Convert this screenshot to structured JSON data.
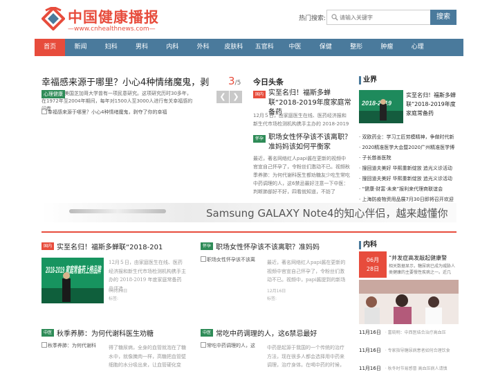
{
  "header": {
    "logo_title": "中国健康播报",
    "logo_url": "—www.cnhealthnews.com—",
    "search_label": "热门搜索:",
    "search_placeholder": "请输入关键字",
    "search_button": "搜索"
  },
  "nav": [
    "首页",
    "新闻",
    "妇科",
    "男科",
    "内科",
    "外科",
    "皮肤科",
    "五官科",
    "中医",
    "保健",
    "整形",
    "肿瘤",
    "心理"
  ],
  "featured": {
    "title": "幸福感来源于哪里？小心4种情绪魔鬼，剥",
    "counter_current": "3",
    "counter_total": "/5",
    "tag": "心理健康",
    "desc": "美国芝加哥大学曾有一项民意研究。这项研究历时30多年，在1972年至2004年期间，每年对1500人至3000人进行有关幸福感的问卷",
    "image_alt": "幸福感来源于哪里？小心4种情绪魔鬼，剥夺了你的幸福",
    "prev": "❮",
    "next": "❯"
  },
  "today": {
    "heading": "今日头条",
    "items": [
      {
        "tag": "国内",
        "title": "实至名归！福斯多蝉联“2018-2019年度家庭常备药",
        "desc": "12月５日，由家庭医生在线、医药经济报和新生代市场检测机构携手主办的 2018-2019"
      },
      {
        "tag": "怀孕",
        "title": "职场女性怀孕该不该离职？准妈妈该如何平衡家",
        "desc": "最近，著名网络红人papi酱在更新的视频中官宣自己怀孕了，令粉丝们激动不已。视频秋季养肺：为何代谢科医生都劝糖友少吃生常吃中药调理的人，这6禁忌最好注意一下中医：判断肺部好不好，四看就知道，不妨了"
      }
    ]
  },
  "side_industry": {
    "heading": "业界",
    "feature_title": "实至名归！福斯多蝉联“2018-2019年度家庭常备药",
    "items": [
      "· 双欧药业：学习工匠劳模精神，争做时代新",
      "· 2020精准医学大会暨2020广州精准医学博",
      "· 子长慈善医院",
      "· 搜回道夫美好 华熙重新绽放 追光义诊活动",
      "· 搜回道夫美好 华熙重新绽放 追光义诊活动",
      "· “健康·财富·未来”报利来代理商联谊会",
      "· 上海防疫物资用品展7月30日即将召开欢迎"
    ]
  },
  "banner": {
    "text": "Samsung GALAXY Note4的知心伴侣，越来越懂你"
  },
  "cards": [
    {
      "tag": "国内",
      "title": "实至名归！福斯多蝉联“2018-201",
      "img_caption": "2018-2019 家庭常备药上榜品牌",
      "desc": "12月５日，由家庭医生在线、医药经济报和新生代市场检测机构携手主办的 2018-2019 年度家庭常备药品评选",
      "date": "06月28日",
      "meta": "标签:"
    },
    {
      "tag": "怀孕",
      "title": "职场女性怀孕该不该离职？准妈妈",
      "img_alt": "职场女性怀孕该不该离",
      "desc": "最近，著名网络红人papi酱在更新的视频中官宣自己怀孕了，令粉丝们激动不已。视频中，papi酱提到的新场",
      "date": "12月16日",
      "meta": "标签:"
    },
    {
      "tag": "中医",
      "title": "秋季养肺：为何代谢科医生劝糖",
      "img_alt": "秋季养肺：为何代谢科",
      "desc": "得了糖尿病，全身的血管就泡在了糖水中，就像腌肉一样，高糖把血管壁细胞的水分吸出来，让血管硬化变"
    },
    {
      "tag": "中医",
      "title": "常吃中药调理的人，这6禁忌最好",
      "img_alt": "常吃中药调理的人，这",
      "desc": "中药是起源于我国的一个传统的治疗方法，现在很多人都会选择用中药来调理，治疗身体。在喝中药的时候，其"
    }
  ],
  "side_internal": {
    "heading": "内科",
    "badge_month": "06月",
    "badge_day": "28日",
    "feature_title": "“并发症高发敲起健康警",
    "feature_desc": "相关数据显示，糖尿病已成为威胁人类健康的主要慢性疾病之一。近几",
    "items": [
      {
        "date": "11月16日",
        "text": "· 富晓明：中西医结合治疗高血压"
      },
      {
        "date": "11月16日",
        "text": "· 专家指导糖尿病患者如何合理饮食"
      },
      {
        "date": "11月16日",
        "text": "· 秋冬时节易感冒 高血压病人请慎"
      }
    ]
  },
  "colors": {
    "accent": "#e74c3c",
    "nav": "#4a7a9c",
    "tag_green": "#2e8b57"
  }
}
